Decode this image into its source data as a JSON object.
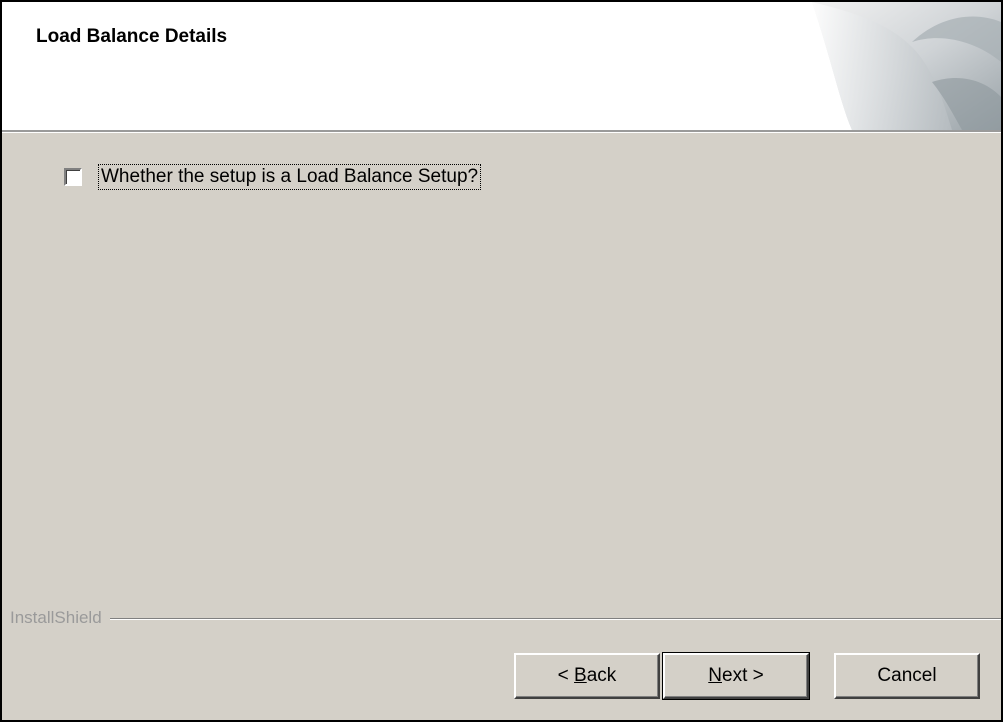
{
  "header": {
    "title": "Load Balance Details"
  },
  "option": {
    "checkbox_label": "Whether the setup is a Load Balance Setup?",
    "checked": false
  },
  "brand": {
    "label": "InstallShield"
  },
  "buttons": {
    "back_prefix": "< ",
    "back_mnemonic": "B",
    "back_rest": "ack",
    "next_mnemonic": "N",
    "next_rest": "ext >",
    "cancel": "Cancel"
  },
  "colors": {
    "dialog_bg": "#d4d0c8",
    "header_bg": "#ffffff",
    "brand_text": "#9a9a9a"
  },
  "icons": {
    "header_graphic": "page-curl-graphic"
  }
}
